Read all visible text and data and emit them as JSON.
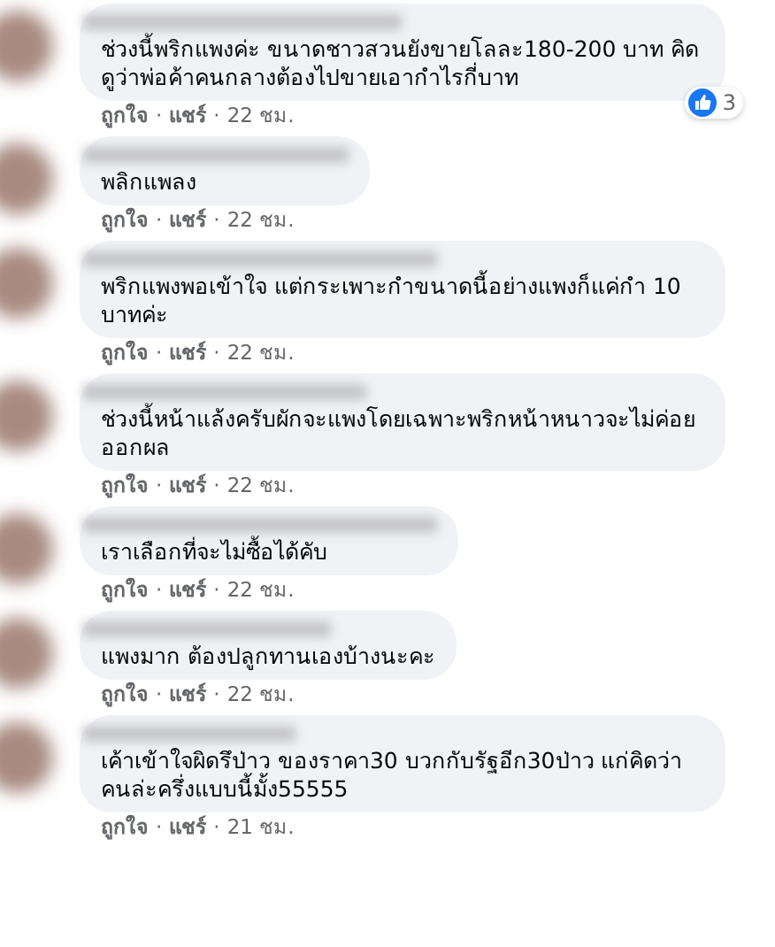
{
  "comments": [
    {
      "text": "ช่วงนี้พริกแพงค่ะ ขนาดชาวสวนยังขายโลละ180-200 บาท คิดดูว่าพ่อค้าคนกลางต้องไปขายเอากำไรกี่บาท",
      "reactions": {
        "count": "3"
      },
      "meta": [
        {
          "kind": "link",
          "text": "ถูกใจ"
        },
        {
          "kind": "dot",
          "text": "·"
        },
        {
          "kind": "link",
          "text": "แชร์"
        },
        {
          "kind": "dot",
          "text": "·"
        },
        {
          "kind": "time",
          "text": "22 ชม."
        }
      ]
    },
    {
      "text": "พลิกแพลง",
      "meta": [
        {
          "kind": "link",
          "text": "ถูกใจ"
        },
        {
          "kind": "dot",
          "text": "·"
        },
        {
          "kind": "link",
          "text": "แชร์"
        },
        {
          "kind": "dot",
          "text": "·"
        },
        {
          "kind": "time",
          "text": "22 ชม."
        }
      ]
    },
    {
      "text": "พริกแพงพอเข้าใจ แต่กระเพาะกำขนาดนี้อย่างแพงก็แค่กำ 10 บาทค่ะ",
      "meta": [
        {
          "kind": "link",
          "text": "ถูกใจ"
        },
        {
          "kind": "dot",
          "text": "·"
        },
        {
          "kind": "link",
          "text": "แชร์"
        },
        {
          "kind": "dot",
          "text": "·"
        },
        {
          "kind": "time",
          "text": "22 ชม."
        }
      ]
    },
    {
      "text": "ช่วงนี้หน้าแล้งครับผักจะแพงโดยเฉพาะพริกหน้าหนาวจะไม่ค่อยออกผล",
      "meta": [
        {
          "kind": "link",
          "text": "ถูกใจ"
        },
        {
          "kind": "dot",
          "text": "·"
        },
        {
          "kind": "link",
          "text": "แชร์"
        },
        {
          "kind": "dot",
          "text": "·"
        },
        {
          "kind": "time",
          "text": "22 ชม."
        }
      ]
    },
    {
      "text": "เราเลือกที่จะไม่ซื้อได้คับ",
      "meta": [
        {
          "kind": "link",
          "text": "ถูกใจ"
        },
        {
          "kind": "dot",
          "text": "·"
        },
        {
          "kind": "link",
          "text": "แชร์"
        },
        {
          "kind": "dot",
          "text": "·"
        },
        {
          "kind": "time",
          "text": "22 ชม."
        }
      ]
    },
    {
      "text": "แพงมาก ต้องปลูกทานเองบ้างนะคะ",
      "meta": [
        {
          "kind": "link",
          "text": "ถูกใจ"
        },
        {
          "kind": "dot",
          "text": "·"
        },
        {
          "kind": "link",
          "text": "แชร์"
        },
        {
          "kind": "dot",
          "text": "·"
        },
        {
          "kind": "time",
          "text": "22 ชม."
        }
      ]
    },
    {
      "text": "เค้าเข้าใจผิดรึป่าว ของราคา30 บวกกับรัฐอีก30ป่าว แก่คิดว่าคนล่ะครึ่งแบบนี้มั้ง55555",
      "meta": [
        {
          "kind": "link",
          "text": "ถูกใจ"
        },
        {
          "kind": "dot",
          "text": "·"
        },
        {
          "kind": "link",
          "text": "แชร์"
        },
        {
          "kind": "dot",
          "text": "·"
        },
        {
          "kind": "time",
          "text": "21 ชม."
        }
      ]
    }
  ]
}
